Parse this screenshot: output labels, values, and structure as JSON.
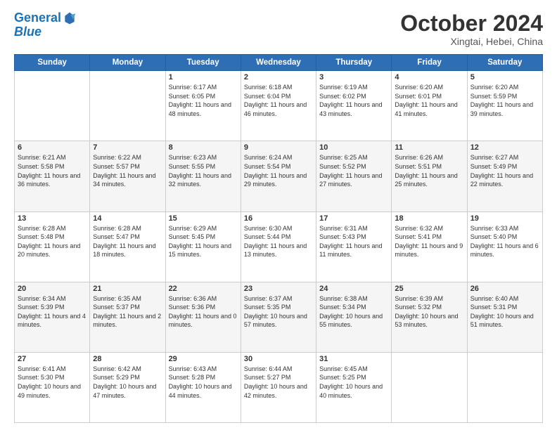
{
  "header": {
    "logo_line1": "General",
    "logo_line2": "Blue",
    "month": "October 2024",
    "location": "Xingtai, Hebei, China"
  },
  "weekdays": [
    "Sunday",
    "Monday",
    "Tuesday",
    "Wednesday",
    "Thursday",
    "Friday",
    "Saturday"
  ],
  "weeks": [
    [
      {
        "day": null,
        "info": null
      },
      {
        "day": null,
        "info": null
      },
      {
        "day": "1",
        "info": "Sunrise: 6:17 AM\nSunset: 6:05 PM\nDaylight: 11 hours and 48 minutes."
      },
      {
        "day": "2",
        "info": "Sunrise: 6:18 AM\nSunset: 6:04 PM\nDaylight: 11 hours and 46 minutes."
      },
      {
        "day": "3",
        "info": "Sunrise: 6:19 AM\nSunset: 6:02 PM\nDaylight: 11 hours and 43 minutes."
      },
      {
        "day": "4",
        "info": "Sunrise: 6:20 AM\nSunset: 6:01 PM\nDaylight: 11 hours and 41 minutes."
      },
      {
        "day": "5",
        "info": "Sunrise: 6:20 AM\nSunset: 5:59 PM\nDaylight: 11 hours and 39 minutes."
      }
    ],
    [
      {
        "day": "6",
        "info": "Sunrise: 6:21 AM\nSunset: 5:58 PM\nDaylight: 11 hours and 36 minutes."
      },
      {
        "day": "7",
        "info": "Sunrise: 6:22 AM\nSunset: 5:57 PM\nDaylight: 11 hours and 34 minutes."
      },
      {
        "day": "8",
        "info": "Sunrise: 6:23 AM\nSunset: 5:55 PM\nDaylight: 11 hours and 32 minutes."
      },
      {
        "day": "9",
        "info": "Sunrise: 6:24 AM\nSunset: 5:54 PM\nDaylight: 11 hours and 29 minutes."
      },
      {
        "day": "10",
        "info": "Sunrise: 6:25 AM\nSunset: 5:52 PM\nDaylight: 11 hours and 27 minutes."
      },
      {
        "day": "11",
        "info": "Sunrise: 6:26 AM\nSunset: 5:51 PM\nDaylight: 11 hours and 25 minutes."
      },
      {
        "day": "12",
        "info": "Sunrise: 6:27 AM\nSunset: 5:49 PM\nDaylight: 11 hours and 22 minutes."
      }
    ],
    [
      {
        "day": "13",
        "info": "Sunrise: 6:28 AM\nSunset: 5:48 PM\nDaylight: 11 hours and 20 minutes."
      },
      {
        "day": "14",
        "info": "Sunrise: 6:28 AM\nSunset: 5:47 PM\nDaylight: 11 hours and 18 minutes."
      },
      {
        "day": "15",
        "info": "Sunrise: 6:29 AM\nSunset: 5:45 PM\nDaylight: 11 hours and 15 minutes."
      },
      {
        "day": "16",
        "info": "Sunrise: 6:30 AM\nSunset: 5:44 PM\nDaylight: 11 hours and 13 minutes."
      },
      {
        "day": "17",
        "info": "Sunrise: 6:31 AM\nSunset: 5:43 PM\nDaylight: 11 hours and 11 minutes."
      },
      {
        "day": "18",
        "info": "Sunrise: 6:32 AM\nSunset: 5:41 PM\nDaylight: 11 hours and 9 minutes."
      },
      {
        "day": "19",
        "info": "Sunrise: 6:33 AM\nSunset: 5:40 PM\nDaylight: 11 hours and 6 minutes."
      }
    ],
    [
      {
        "day": "20",
        "info": "Sunrise: 6:34 AM\nSunset: 5:39 PM\nDaylight: 11 hours and 4 minutes."
      },
      {
        "day": "21",
        "info": "Sunrise: 6:35 AM\nSunset: 5:37 PM\nDaylight: 11 hours and 2 minutes."
      },
      {
        "day": "22",
        "info": "Sunrise: 6:36 AM\nSunset: 5:36 PM\nDaylight: 11 hours and 0 minutes."
      },
      {
        "day": "23",
        "info": "Sunrise: 6:37 AM\nSunset: 5:35 PM\nDaylight: 10 hours and 57 minutes."
      },
      {
        "day": "24",
        "info": "Sunrise: 6:38 AM\nSunset: 5:34 PM\nDaylight: 10 hours and 55 minutes."
      },
      {
        "day": "25",
        "info": "Sunrise: 6:39 AM\nSunset: 5:32 PM\nDaylight: 10 hours and 53 minutes."
      },
      {
        "day": "26",
        "info": "Sunrise: 6:40 AM\nSunset: 5:31 PM\nDaylight: 10 hours and 51 minutes."
      }
    ],
    [
      {
        "day": "27",
        "info": "Sunrise: 6:41 AM\nSunset: 5:30 PM\nDaylight: 10 hours and 49 minutes."
      },
      {
        "day": "28",
        "info": "Sunrise: 6:42 AM\nSunset: 5:29 PM\nDaylight: 10 hours and 47 minutes."
      },
      {
        "day": "29",
        "info": "Sunrise: 6:43 AM\nSunset: 5:28 PM\nDaylight: 10 hours and 44 minutes."
      },
      {
        "day": "30",
        "info": "Sunrise: 6:44 AM\nSunset: 5:27 PM\nDaylight: 10 hours and 42 minutes."
      },
      {
        "day": "31",
        "info": "Sunrise: 6:45 AM\nSunset: 5:25 PM\nDaylight: 10 hours and 40 minutes."
      },
      {
        "day": null,
        "info": null
      },
      {
        "day": null,
        "info": null
      }
    ]
  ]
}
